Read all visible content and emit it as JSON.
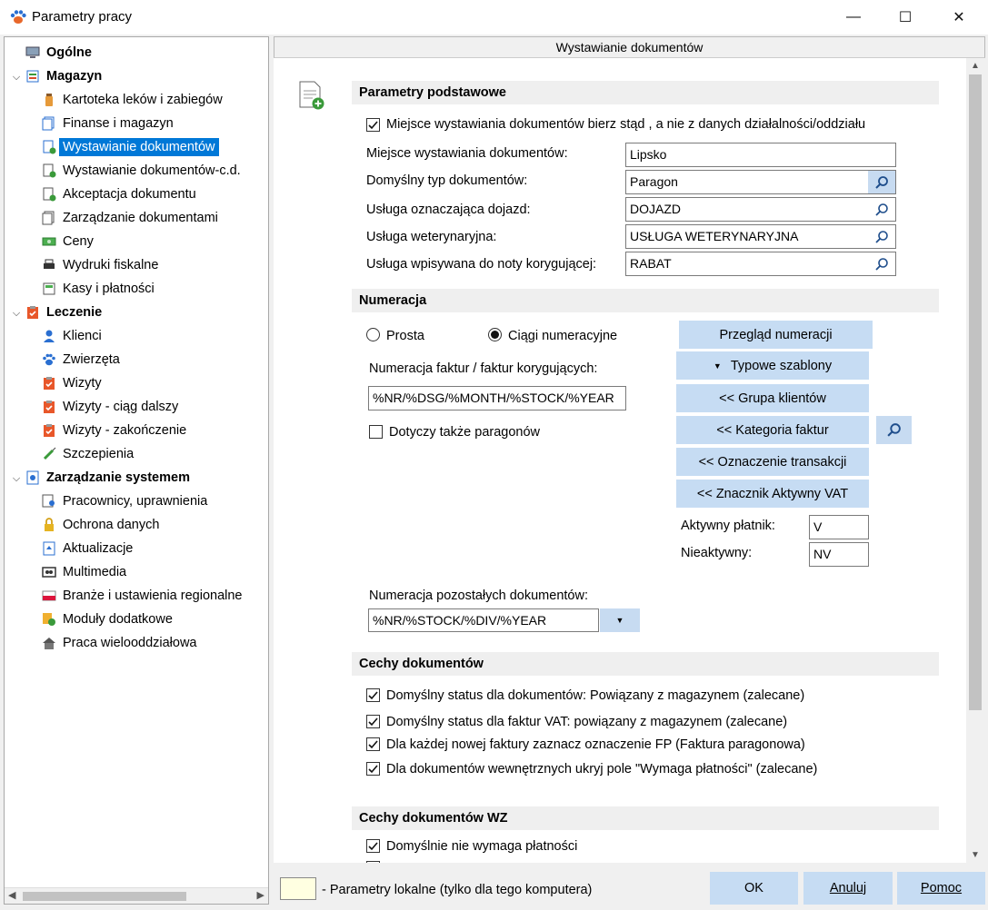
{
  "window": {
    "title": "Parametry pracy",
    "minimize": "—",
    "maximize": "☐",
    "close": "✕"
  },
  "tree": {
    "items": [
      {
        "label": "Ogólne",
        "bold": true
      },
      {
        "label": "Magazyn",
        "bold": true
      },
      {
        "label": "Kartoteka leków i zabiegów"
      },
      {
        "label": "Finanse i magazyn"
      },
      {
        "label": "Wystawianie dokumentów",
        "selected": true
      },
      {
        "label": "Wystawianie dokumentów-c.d."
      },
      {
        "label": "Akceptacja dokumentu"
      },
      {
        "label": "Zarządzanie dokumentami"
      },
      {
        "label": "Ceny"
      },
      {
        "label": "Wydruki fiskalne"
      },
      {
        "label": "Kasy i płatności"
      },
      {
        "label": "Leczenie",
        "bold": true
      },
      {
        "label": "Klienci"
      },
      {
        "label": "Zwierzęta"
      },
      {
        "label": "Wizyty"
      },
      {
        "label": "Wizyty - ciąg dalszy"
      },
      {
        "label": "Wizyty - zakończenie"
      },
      {
        "label": "Szczepienia"
      },
      {
        "label": "Zarządzanie systemem",
        "bold": true
      },
      {
        "label": "Pracownicy, uprawnienia"
      },
      {
        "label": "Ochrona danych"
      },
      {
        "label": "Aktualizacje"
      },
      {
        "label": "Multimedia"
      },
      {
        "label": "Branże i ustawienia regionalne"
      },
      {
        "label": "Moduły dodatkowe"
      },
      {
        "label": "Praca wielooddziałowa"
      }
    ]
  },
  "page": {
    "header": "Wystawianie dokumentów"
  },
  "basic": {
    "title": "Parametry podstawowe",
    "checkbox_place": "Miejsce wystawiania dokumentów bierz stąd , a nie z danych działalności/oddziału",
    "place_label": "Miejsce wystawiania dokumentów:",
    "place_value": "Lipsko",
    "doctype_label": "Domyślny typ dokumentów:",
    "doctype_value": "Paragon",
    "travel_label": "Usługa oznaczająca dojazd:",
    "travel_value": "DOJAZD",
    "vet_label": "Usługa weterynaryjna:",
    "vet_value": "USŁUGA WETERYNARYJNA",
    "corr_label": "Usługa wpisywana do noty korygującej:",
    "corr_value": "RABAT"
  },
  "numbering": {
    "title": "Numeracja",
    "radio_simple": "Prosta",
    "radio_sequences": "Ciągi numeracyjne",
    "review_btn": "Przegląd numeracji",
    "templates_btn": "Typowe szablony",
    "invoice_label": "Numeracja faktur / faktur korygujących:",
    "invoice_value": "%NR/%DSG/%MONTH/%STOCK/%YEAR",
    "receipts_check": "Dotyczy także paragonów",
    "client_group_btn": "<< Grupa klientów",
    "invoice_cat_btn": "<< Kategoria faktur",
    "transaction_btn": "<< Oznaczenie transakcji",
    "vat_btn": "<< Znacznik Aktywny VAT",
    "active_label": "Aktywny płatnik:",
    "active_value": "V",
    "inactive_label": "Nieaktywny:",
    "inactive_value": "NV",
    "other_label": "Numeracja pozostałych dokumentów:",
    "other_value": "%NR/%STOCK/%DIV/%YEAR"
  },
  "features": {
    "title": "Cechy dokumentów",
    "opt1": "Domyślny status dla dokumentów: Powiązany z magazynem (zalecane)",
    "opt2": "Domyślny status dla faktur VAT: powiązany z magazynem (zalecane)",
    "opt3": "Dla każdej nowej faktury  zaznacz oznaczenie FP (Faktura paragonowa)",
    "opt4": "Dla dokumentów wewnętrznych ukryj pole \"Wymaga płatności\" (zalecane)"
  },
  "wz": {
    "title": "Cechy dokumentów WZ",
    "opt1": "Domyślnie nie wymaga płatności"
  },
  "footer": {
    "legend": "- Parametry lokalne (tylko dla tego komputera)",
    "ok": "OK",
    "cancel": "Anuluj",
    "help": "Pomoc"
  }
}
